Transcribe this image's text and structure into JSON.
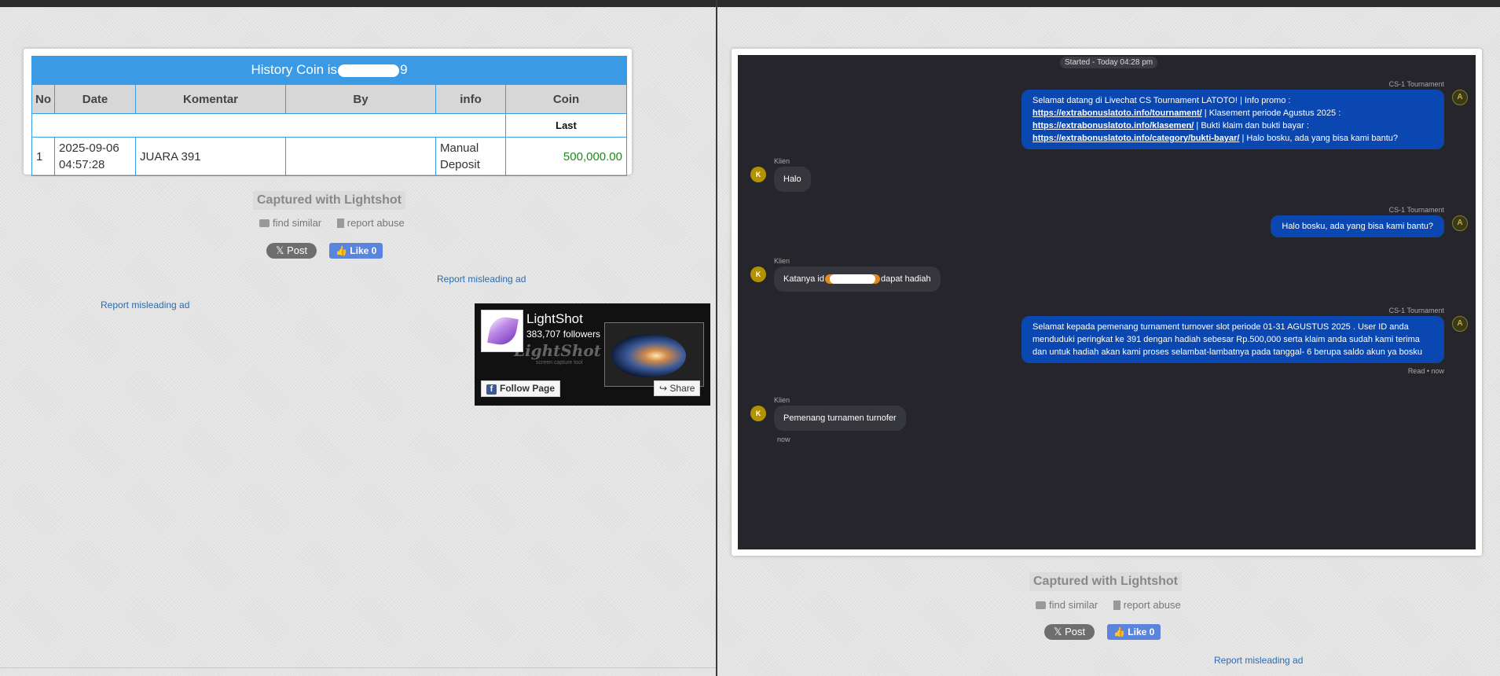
{
  "left": {
    "title_prefix": "History Coin is",
    "title_suffix": "9",
    "table": {
      "headers": [
        "No",
        "Date",
        "Komentar",
        "By",
        "info",
        "Coin"
      ],
      "last_label": "Last",
      "rows": [
        {
          "no": "1",
          "date": "2025-09-06 04:57:28",
          "komentar": "JUARA 391",
          "by": "",
          "info": "Manual Deposit",
          "coin": "500,000.00"
        }
      ]
    },
    "captured": "Captured with Lightshot",
    "find_similar": "find similar",
    "report_abuse": "report abuse",
    "post_label": "Post",
    "like_label": "Like 0",
    "report_ad_1": "Report misleading ad",
    "report_ad_2": "Report misleading ad",
    "fb": {
      "name": "LightShot",
      "followers": "383,707 followers",
      "watermark": "LightShot",
      "watermark_sub": "screen capture tool",
      "follow_label": "Follow Page",
      "share_label": "Share"
    }
  },
  "right": {
    "started": "Started - Today 04:28 pm",
    "agent_name": "CS-1 Tournament",
    "client_name": "Klien",
    "client_initial": "K",
    "agent_initial": "A",
    "m1_a": "Selamat datang di Livechat CS Tournament LATOTO! | Info promo : ",
    "m1_link1": "https://extrabonuslatoto.info/tournament/",
    "m1_b": " | Klasement periode Agustus 2025 : ",
    "m1_link2": "https://extrabonuslatoto.info/klasemen/",
    "m1_c": " | Bukti klaim dan bukti bayar : ",
    "m1_link3": "https://extrabonuslatoto.info/category/bukti-bayar/",
    "m1_d": " | Halo bosku, ada yang bisa kami bantu?",
    "k1": "Halo",
    "m2": "Halo bosku, ada yang bisa kami bantu?",
    "k2_a": "Katanya id",
    "k2_b": "dapat hadiah",
    "m3": "Selamat kepada pemenang turnament turnover slot periode 01-31 AGUSTUS 2025 . User ID anda menduduki peringkat ke 391 dengan hadiah sebesar Rp.500,000 serta klaim anda sudah kami terima dan untuk hadiah akan kami proses selambat-lambatnya pada tanggal- 6 berupa saldo akun ya bosku",
    "read_status": "Read • now",
    "k3": "Pemenang turnamen turnofer",
    "k3_time": "now",
    "captured": "Captured with Lightshot",
    "find_similar": "find similar",
    "report_abuse": "report abuse",
    "post_label": "Post",
    "like_label": "Like 0",
    "report_ad": "Report misleading ad"
  }
}
